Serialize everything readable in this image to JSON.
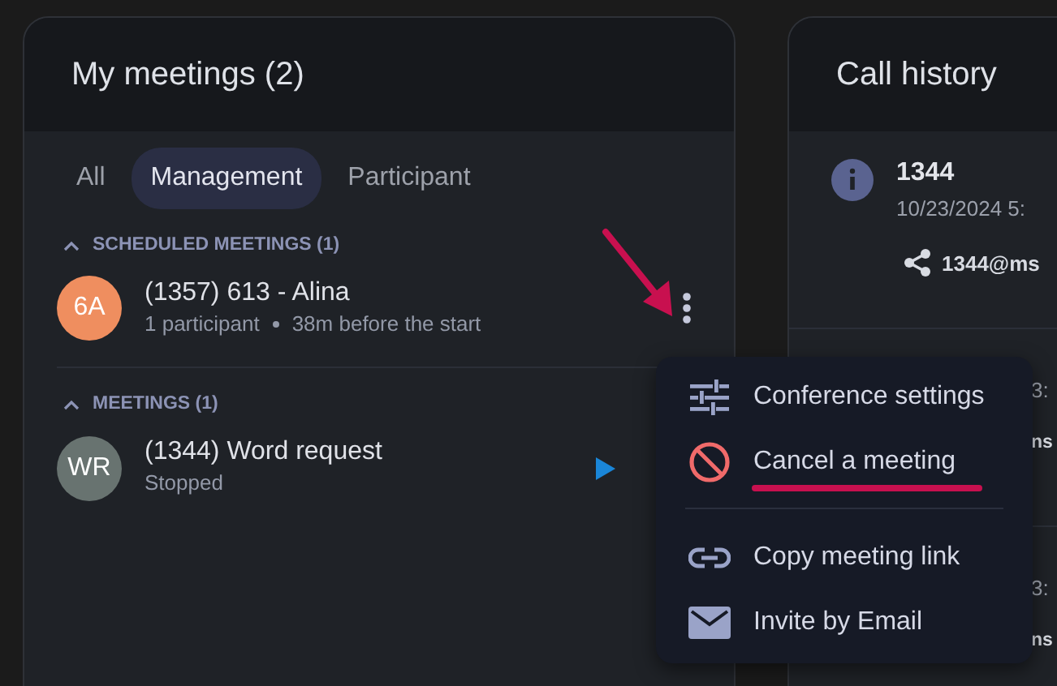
{
  "meetings_panel": {
    "title": "My meetings (2)",
    "tabs": [
      {
        "label": "All",
        "selected": false
      },
      {
        "label": "Management",
        "selected": true
      },
      {
        "label": "Participant",
        "selected": false
      }
    ],
    "sections": [
      {
        "title": "SCHEDULED MEETINGS (1)",
        "expanded": true,
        "items": [
          {
            "avatar": "6A",
            "color": "#ef8e5f",
            "name": "(1357) 613 - Alina",
            "participants": "1 participant",
            "time": "38m before the start",
            "kind": "more"
          }
        ]
      },
      {
        "title": "MEETINGS (1)",
        "expanded": true,
        "items": [
          {
            "avatar": "WR",
            "color": "#687370",
            "name": "(1344) Word request",
            "status": "Stopped",
            "kind": "play"
          }
        ]
      }
    ]
  },
  "call_history": {
    "title": "Call history",
    "items": [
      {
        "kind": "full",
        "title": "1344",
        "date": "10/23/2024 5:",
        "link": "1344@ms"
      },
      {
        "kind": "covered",
        "date": "3:",
        "link": "ns"
      },
      {
        "kind": "covered",
        "date": "3:",
        "link": "ns"
      }
    ]
  },
  "context_menu": {
    "items": [
      {
        "kind": "settings",
        "label": "Conference settings",
        "highlighted": false
      },
      {
        "kind": "cancel",
        "label": "Cancel a meeting",
        "highlighted": true
      },
      {
        "kind": "link",
        "label": "Copy meeting link",
        "highlighted": false
      },
      {
        "kind": "email",
        "label": "Invite by Email",
        "highlighted": false
      }
    ]
  }
}
